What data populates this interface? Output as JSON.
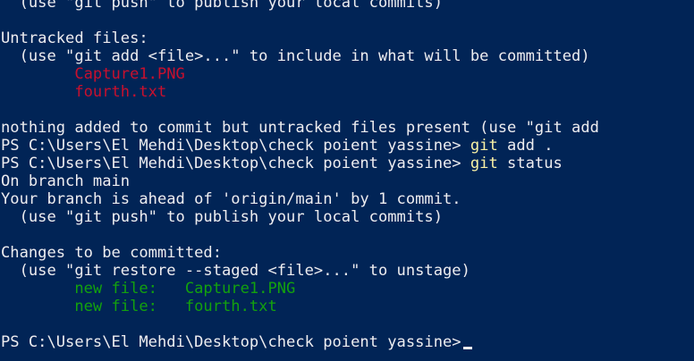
{
  "terminal": {
    "colors": {
      "background": "#012456",
      "default": "#eeedf0",
      "red": "#c8102e",
      "green": "#13a10e",
      "yellow": "#f9f1a5"
    },
    "lines": [
      [
        {
          "text": "  (use \"git push\" to publish your local commits)",
          "color": "default"
        }
      ],
      [],
      [
        {
          "text": "Untracked files:",
          "color": "default"
        }
      ],
      [
        {
          "text": "  (use \"git add <file>...\" to include in what will be committed)",
          "color": "default"
        }
      ],
      [
        {
          "text": "        ",
          "color": "default"
        },
        {
          "text": "Capture1.PNG",
          "color": "red"
        }
      ],
      [
        {
          "text": "        ",
          "color": "default"
        },
        {
          "text": "fourth.txt",
          "color": "red"
        }
      ],
      [],
      [
        {
          "text": "nothing added to commit but untracked files present (use \"git add",
          "color": "default"
        }
      ],
      [
        {
          "text": "PS C:\\Users\\El Mehdi\\Desktop\\check poient yassine> ",
          "color": "default"
        },
        {
          "text": "git",
          "color": "yellow"
        },
        {
          "text": " add .",
          "color": "default"
        }
      ],
      [
        {
          "text": "PS C:\\Users\\El Mehdi\\Desktop\\check poient yassine> ",
          "color": "default"
        },
        {
          "text": "git",
          "color": "yellow"
        },
        {
          "text": " status",
          "color": "default"
        }
      ],
      [
        {
          "text": "On branch main",
          "color": "default"
        }
      ],
      [
        {
          "text": "Your branch is ahead of 'origin/main' by 1 commit.",
          "color": "default"
        }
      ],
      [
        {
          "text": "  (use \"git push\" to publish your local commits)",
          "color": "default"
        }
      ],
      [],
      [
        {
          "text": "Changes to be committed:",
          "color": "default"
        }
      ],
      [
        {
          "text": "  (use \"git restore --staged <file>...\" to unstage)",
          "color": "default"
        }
      ],
      [
        {
          "text": "        ",
          "color": "default"
        },
        {
          "text": "new file:   Capture1.PNG",
          "color": "green"
        }
      ],
      [
        {
          "text": "        ",
          "color": "default"
        },
        {
          "text": "new file:   fourth.txt",
          "color": "green"
        }
      ],
      [],
      [
        {
          "text": "PS C:\\Users\\El Mehdi\\Desktop\\check poient yassine>",
          "color": "default"
        }
      ]
    ]
  }
}
